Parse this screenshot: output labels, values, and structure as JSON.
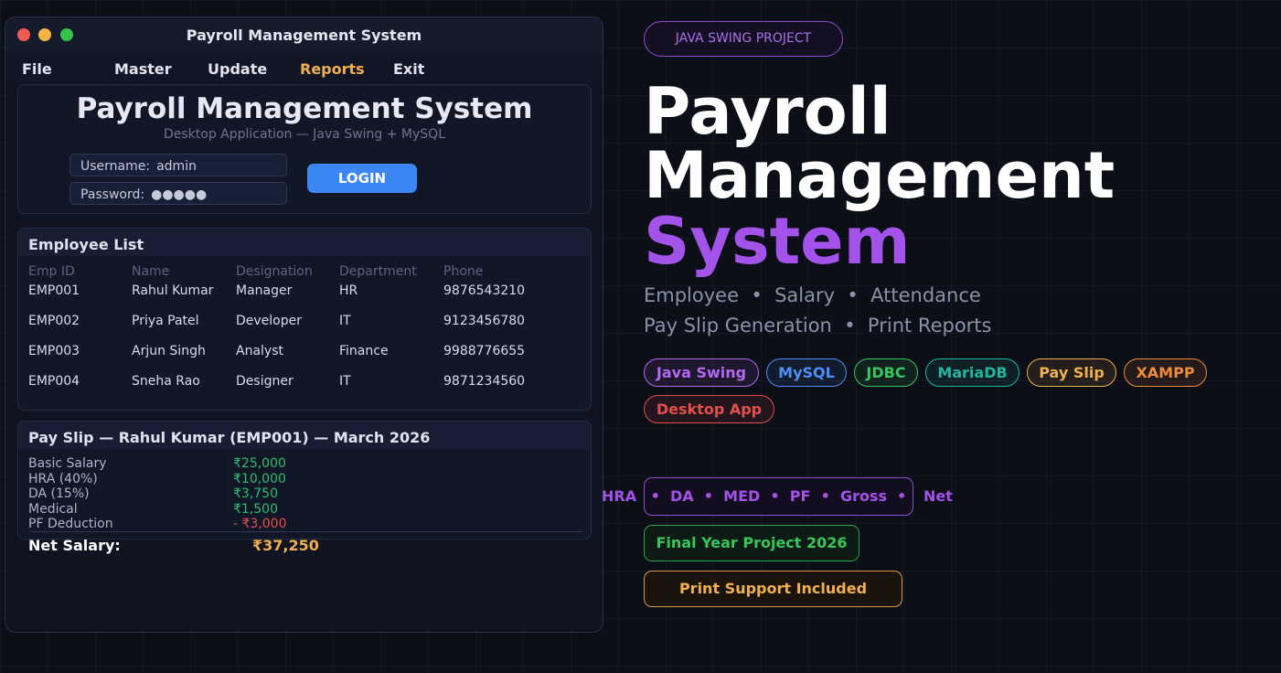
{
  "window": {
    "title": "Payroll Management System",
    "menu": [
      "File",
      "Master",
      "Update",
      "Reports",
      "Exit"
    ],
    "active_menu": "Reports"
  },
  "login": {
    "title": "Payroll Management System",
    "subtitle": "Desktop Application — Java Swing + MySQL",
    "username_label": "Username:",
    "username_value": "admin",
    "password_label": "Password:",
    "password_value": "●●●●●",
    "button": "LOGIN"
  },
  "employees": {
    "header": "Employee List",
    "columns": [
      "Emp ID",
      "Name",
      "Designation",
      "Department",
      "Phone"
    ],
    "rows": [
      [
        "EMP001",
        "Rahul Kumar",
        "Manager",
        "HR",
        "9876543210"
      ],
      [
        "EMP002",
        "Priya Patel",
        "Developer",
        "IT",
        "9123456780"
      ],
      [
        "EMP003",
        "Arjun Singh",
        "Analyst",
        "Finance",
        "9988776655"
      ],
      [
        "EMP004",
        "Sneha Rao",
        "Designer",
        "IT",
        "9871234560"
      ]
    ]
  },
  "payslip": {
    "header": "Pay Slip — Rahul Kumar (EMP001) — March 2026",
    "items": [
      {
        "label": "Basic Salary",
        "value": "₹25,000"
      },
      {
        "label": "HRA (40%)",
        "value": "₹10,000"
      },
      {
        "label": "DA (15%)",
        "value": "₹3,750"
      },
      {
        "label": "Medical",
        "value": "₹1,500"
      },
      {
        "label": "PF Deduction",
        "value": "- ₹3,000"
      }
    ],
    "net_label": "Net Salary:",
    "net_value": "₹37,250"
  },
  "hero": {
    "badge": "JAVA SWING PROJECT",
    "line1": "Payroll",
    "line2": "Management",
    "line3": "System",
    "features_line1": "Employee  •  Salary  •  Attendance",
    "features_line2": "Pay Slip Generation  •  Print Reports"
  },
  "tags": [
    {
      "label": "Java Swing",
      "color": "#b468f0"
    },
    {
      "label": "MySQL",
      "color": "#4d8ff5"
    },
    {
      "label": "JDBC",
      "color": "#36c75c"
    },
    {
      "label": "MariaDB",
      "color": "#22b5a0"
    },
    {
      "label": "Pay Slip",
      "color": "#f1b04f"
    },
    {
      "label": "XAMPP",
      "color": "#ee8a3a"
    },
    {
      "label": "Desktop App",
      "color": "#e2504c"
    }
  ],
  "formula": {
    "left": "HRA",
    "middle": "•  DA  •  MED  •  PF  •  Gross  •",
    "right": "Net"
  },
  "final_year": "Final Year Project 2026",
  "print_support": "Print Support Included"
}
